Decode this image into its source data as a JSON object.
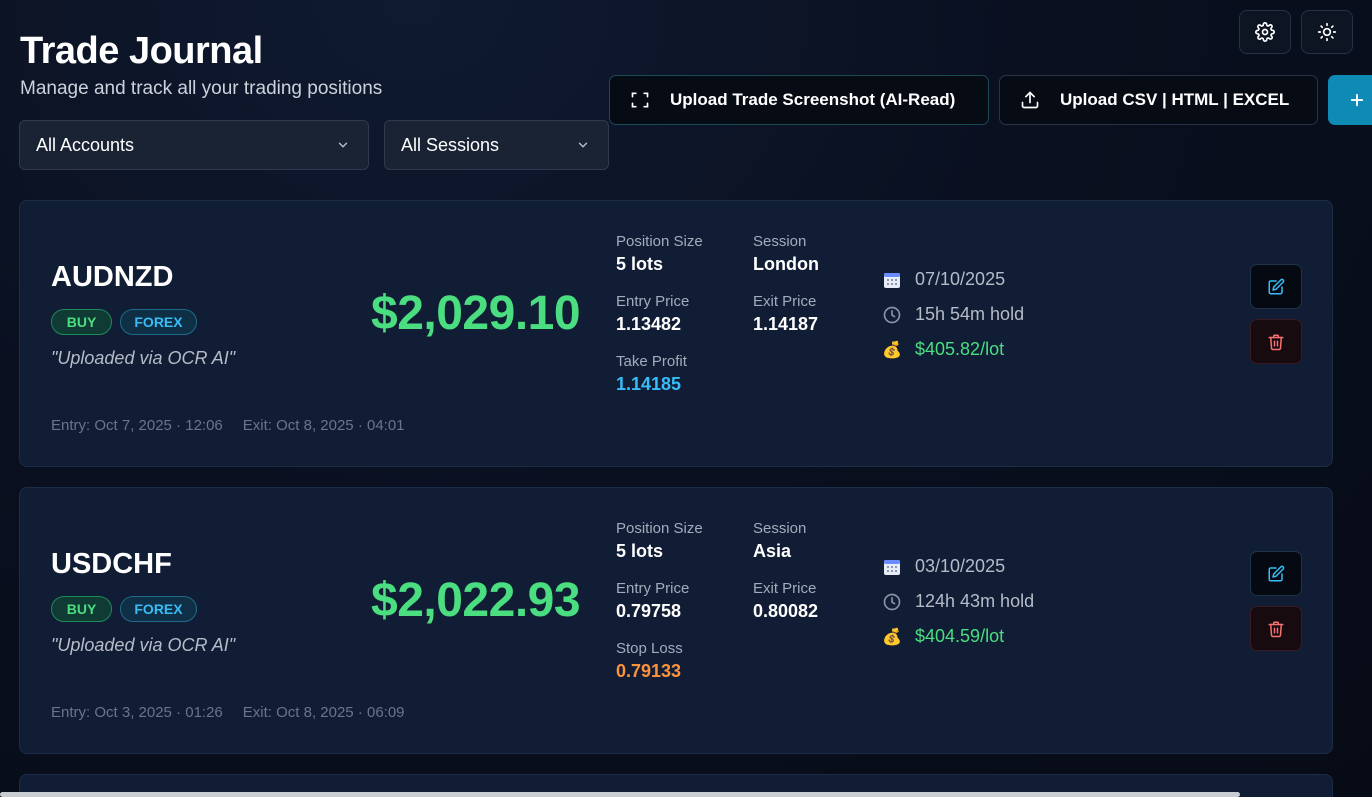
{
  "header": {
    "title": "Trade Journal",
    "subtitle": "Manage and track all your trading positions"
  },
  "toolbar": {
    "settings_icon": "gear-icon",
    "theme_icon": "sun-icon",
    "upload_screenshot_label": "Upload Trade Screenshot (AI-Read)",
    "upload_file_label": "Upload CSV | HTML | EXCEL",
    "add_icon": "plus-icon"
  },
  "filters": {
    "accounts": "All Accounts",
    "sessions": "All Sessions"
  },
  "colors": {
    "profit": "#4ade80",
    "take_profit": "#38bdf8",
    "stop_loss": "#fb923c",
    "accent": "#0e8ab5"
  },
  "trades": [
    {
      "symbol": "AUDNZD",
      "side": "BUY",
      "market": "FOREX",
      "note": "\"Uploaded via OCR AI\"",
      "pnl": "$2,029.10",
      "position_size_label": "Position Size",
      "position_size": "5 lots",
      "session_label": "Session",
      "session": "London",
      "entry_label": "Entry Price",
      "entry": "1.13482",
      "exit_label": "Exit Price",
      "exit": "1.14187",
      "extra_label": "Take Profit",
      "extra": "1.14185",
      "date": "07/10/2025",
      "hold": "15h 54m hold",
      "per_lot": "$405.82/lot",
      "entry_time": "Entry: Oct 7, 2025 · 12:06",
      "exit_time": "Exit: Oct 8, 2025 · 04:01"
    },
    {
      "symbol": "USDCHF",
      "side": "BUY",
      "market": "FOREX",
      "note": "\"Uploaded via OCR AI\"",
      "pnl": "$2,022.93",
      "position_size_label": "Position Size",
      "position_size": "5 lots",
      "session_label": "Session",
      "session": "Asia",
      "entry_label": "Entry Price",
      "entry": "0.79758",
      "exit_label": "Exit Price",
      "exit": "0.80082",
      "extra_label": "Stop Loss",
      "extra": "0.79133",
      "date": "03/10/2025",
      "hold": "124h 43m hold",
      "per_lot": "$404.59/lot",
      "entry_time": "Entry: Oct 3, 2025 · 01:26",
      "exit_time": "Exit: Oct 8, 2025 · 06:09"
    }
  ]
}
